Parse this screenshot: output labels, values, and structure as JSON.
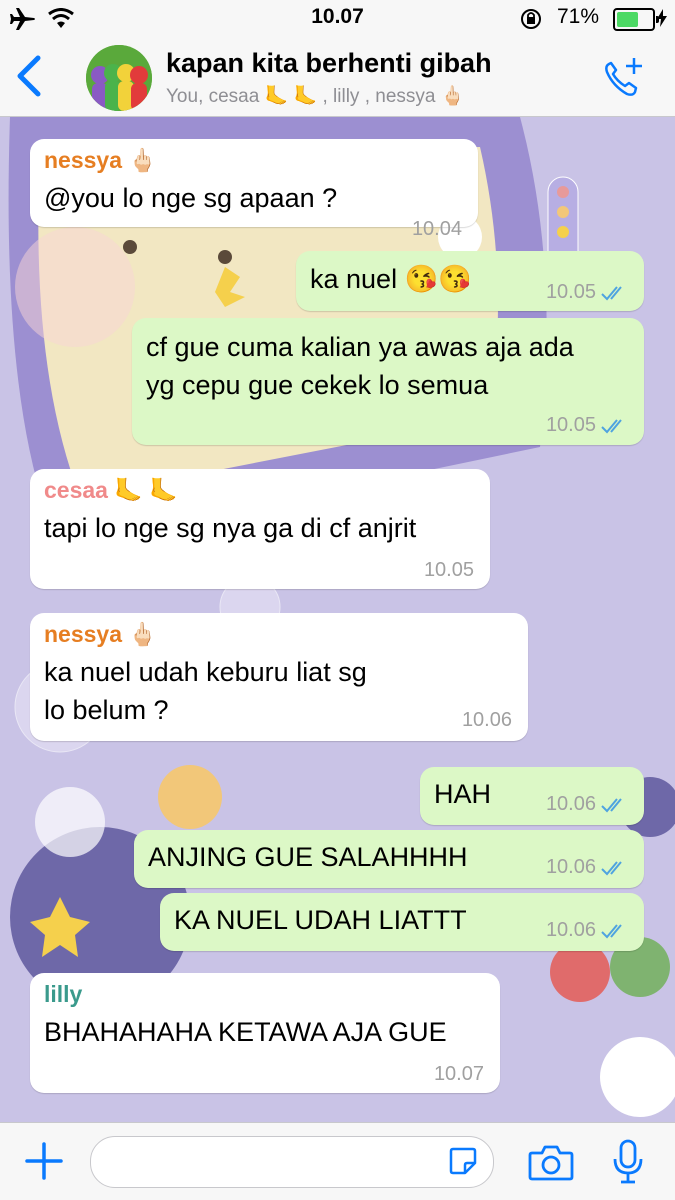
{
  "status_bar": {
    "time": "10.07",
    "battery": "71%",
    "battery_level": 0.71
  },
  "header": {
    "title": "kapan kita berhenti gibah",
    "subtitle": "You, cesaa 🦶 🦶 , lilly , nessya 🖕🏻",
    "icons": [
      "back-chevron",
      "group-avatar",
      "add-call"
    ]
  },
  "messages": [
    {
      "dir": "in",
      "sender": "nessya 🖕🏻",
      "text": [
        "@you lo nge sg apaan ?"
      ],
      "time": "10.04"
    },
    {
      "dir": "out",
      "text": [
        "ka nuel 😘😘"
      ],
      "time": "10.05"
    },
    {
      "dir": "out",
      "text": [
        "cf gue cuma kalian ya awas aja ada",
        "yg cepu gue cekek lo semua"
      ],
      "time": "10.05"
    },
    {
      "dir": "in",
      "sender": "cesaa 🦶 🦶",
      "text": [
        "tapi lo nge sg nya ga di cf anjrit"
      ],
      "time": "10.05"
    },
    {
      "dir": "in",
      "sender": "nessya 🖕🏻",
      "text": [
        "ka nuel udah keburu liat sg",
        "lo belum ?"
      ],
      "time": "10.06"
    },
    {
      "dir": "out",
      "text": [
        "HAH"
      ],
      "time": "10.06"
    },
    {
      "dir": "out",
      "text": [
        "ANJING GUE SALAHHHH"
      ],
      "time": "10.06"
    },
    {
      "dir": "out",
      "text": [
        "KA NUEL UDAH LIATTT"
      ],
      "time": "10.06"
    },
    {
      "dir": "in",
      "sender": "lilly",
      "text": [
        "BHAHAHAHA KETAWA AJA GUE"
      ],
      "time": "10.07"
    }
  ],
  "input_bar": {
    "icons": [
      "plus",
      "sticker",
      "camera",
      "microphone"
    ]
  },
  "colors": {
    "accent": "#0a7afe",
    "outgoing_bubble": "#dcf8c6",
    "incoming_bubble": "#ffffff",
    "wallpaper": "#c9c3e6",
    "sender_nessya": "#e67e22",
    "sender_cesaa": "#f08a8a",
    "sender_lilly": "#3a9a8c",
    "read_ticks": "#4fa3e0"
  }
}
